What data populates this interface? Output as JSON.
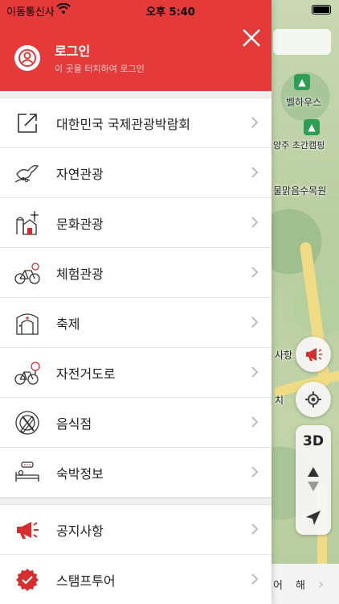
{
  "status_bar": {
    "carrier": "이동통신사",
    "time": "오후 5:40"
  },
  "login": {
    "title": "로그인",
    "subtitle": "이 곳을 터치하여 로그인"
  },
  "menu": {
    "group1": [
      {
        "label": "대한민국 국제관광박람회",
        "icon": "external-link-icon"
      },
      {
        "label": "자연관광",
        "icon": "dove-branch-icon"
      },
      {
        "label": "문화관광",
        "icon": "barn-windmill-icon"
      },
      {
        "label": "체험관광",
        "icon": "bicycle-icon"
      },
      {
        "label": "축제",
        "icon": "gate-sparkle-icon"
      },
      {
        "label": "자전거도로",
        "icon": "bicycle-tree-icon"
      },
      {
        "label": "음식점",
        "icon": "fork-knife-icon"
      },
      {
        "label": "숙박정보",
        "icon": "bed-icon"
      }
    ],
    "group2": [
      {
        "label": "공지사항",
        "icon": "megaphone-icon"
      },
      {
        "label": "스탬프투어",
        "icon": "stamp-icon"
      }
    ]
  },
  "map": {
    "labels": [
      "벨하우스",
      "양주 초간캠핑",
      "물맑음수목원",
      "사항",
      "치",
      "어",
      "해"
    ],
    "view_mode": "3D"
  },
  "colors": {
    "header_red": "#e43a3a",
    "accent_red": "#d62d2d"
  }
}
